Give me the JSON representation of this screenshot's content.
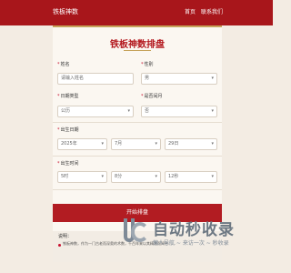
{
  "header": {
    "brand": "铁板神数",
    "nav_home": "首页",
    "nav_contact": "联系我们"
  },
  "form": {
    "title": "铁板神数排盘",
    "name_label": "姓名",
    "name_placeholder": "请输入姓名",
    "gender_label": "性别",
    "gender_value": "男",
    "calendar_label": "日期类型",
    "calendar_value": "公历",
    "leap_label": "是否闰月",
    "leap_value": "否",
    "birth_date_label": "出生日期",
    "year_value": "2025年",
    "month_value": "7月",
    "day_value": "29日",
    "birth_time_label": "出生时间",
    "hour_value": "5时",
    "minute_value": "8分",
    "second_value": "12秒",
    "submit_label": "开始排盘",
    "required_mark": "*",
    "arrow": "▾"
  },
  "info": {
    "title": "说明：",
    "text": "铁板神数，作为一门古老而深奥的术数，千百年来以其精准而闻名……"
  },
  "watermark": {
    "main": "自动秒收录",
    "sub": "懒人导航 ~ 来访一次 ~ 秒收录"
  },
  "colors": {
    "primary": "#a8161b",
    "accent": "#c6a35a",
    "background": "#f3ece3"
  }
}
